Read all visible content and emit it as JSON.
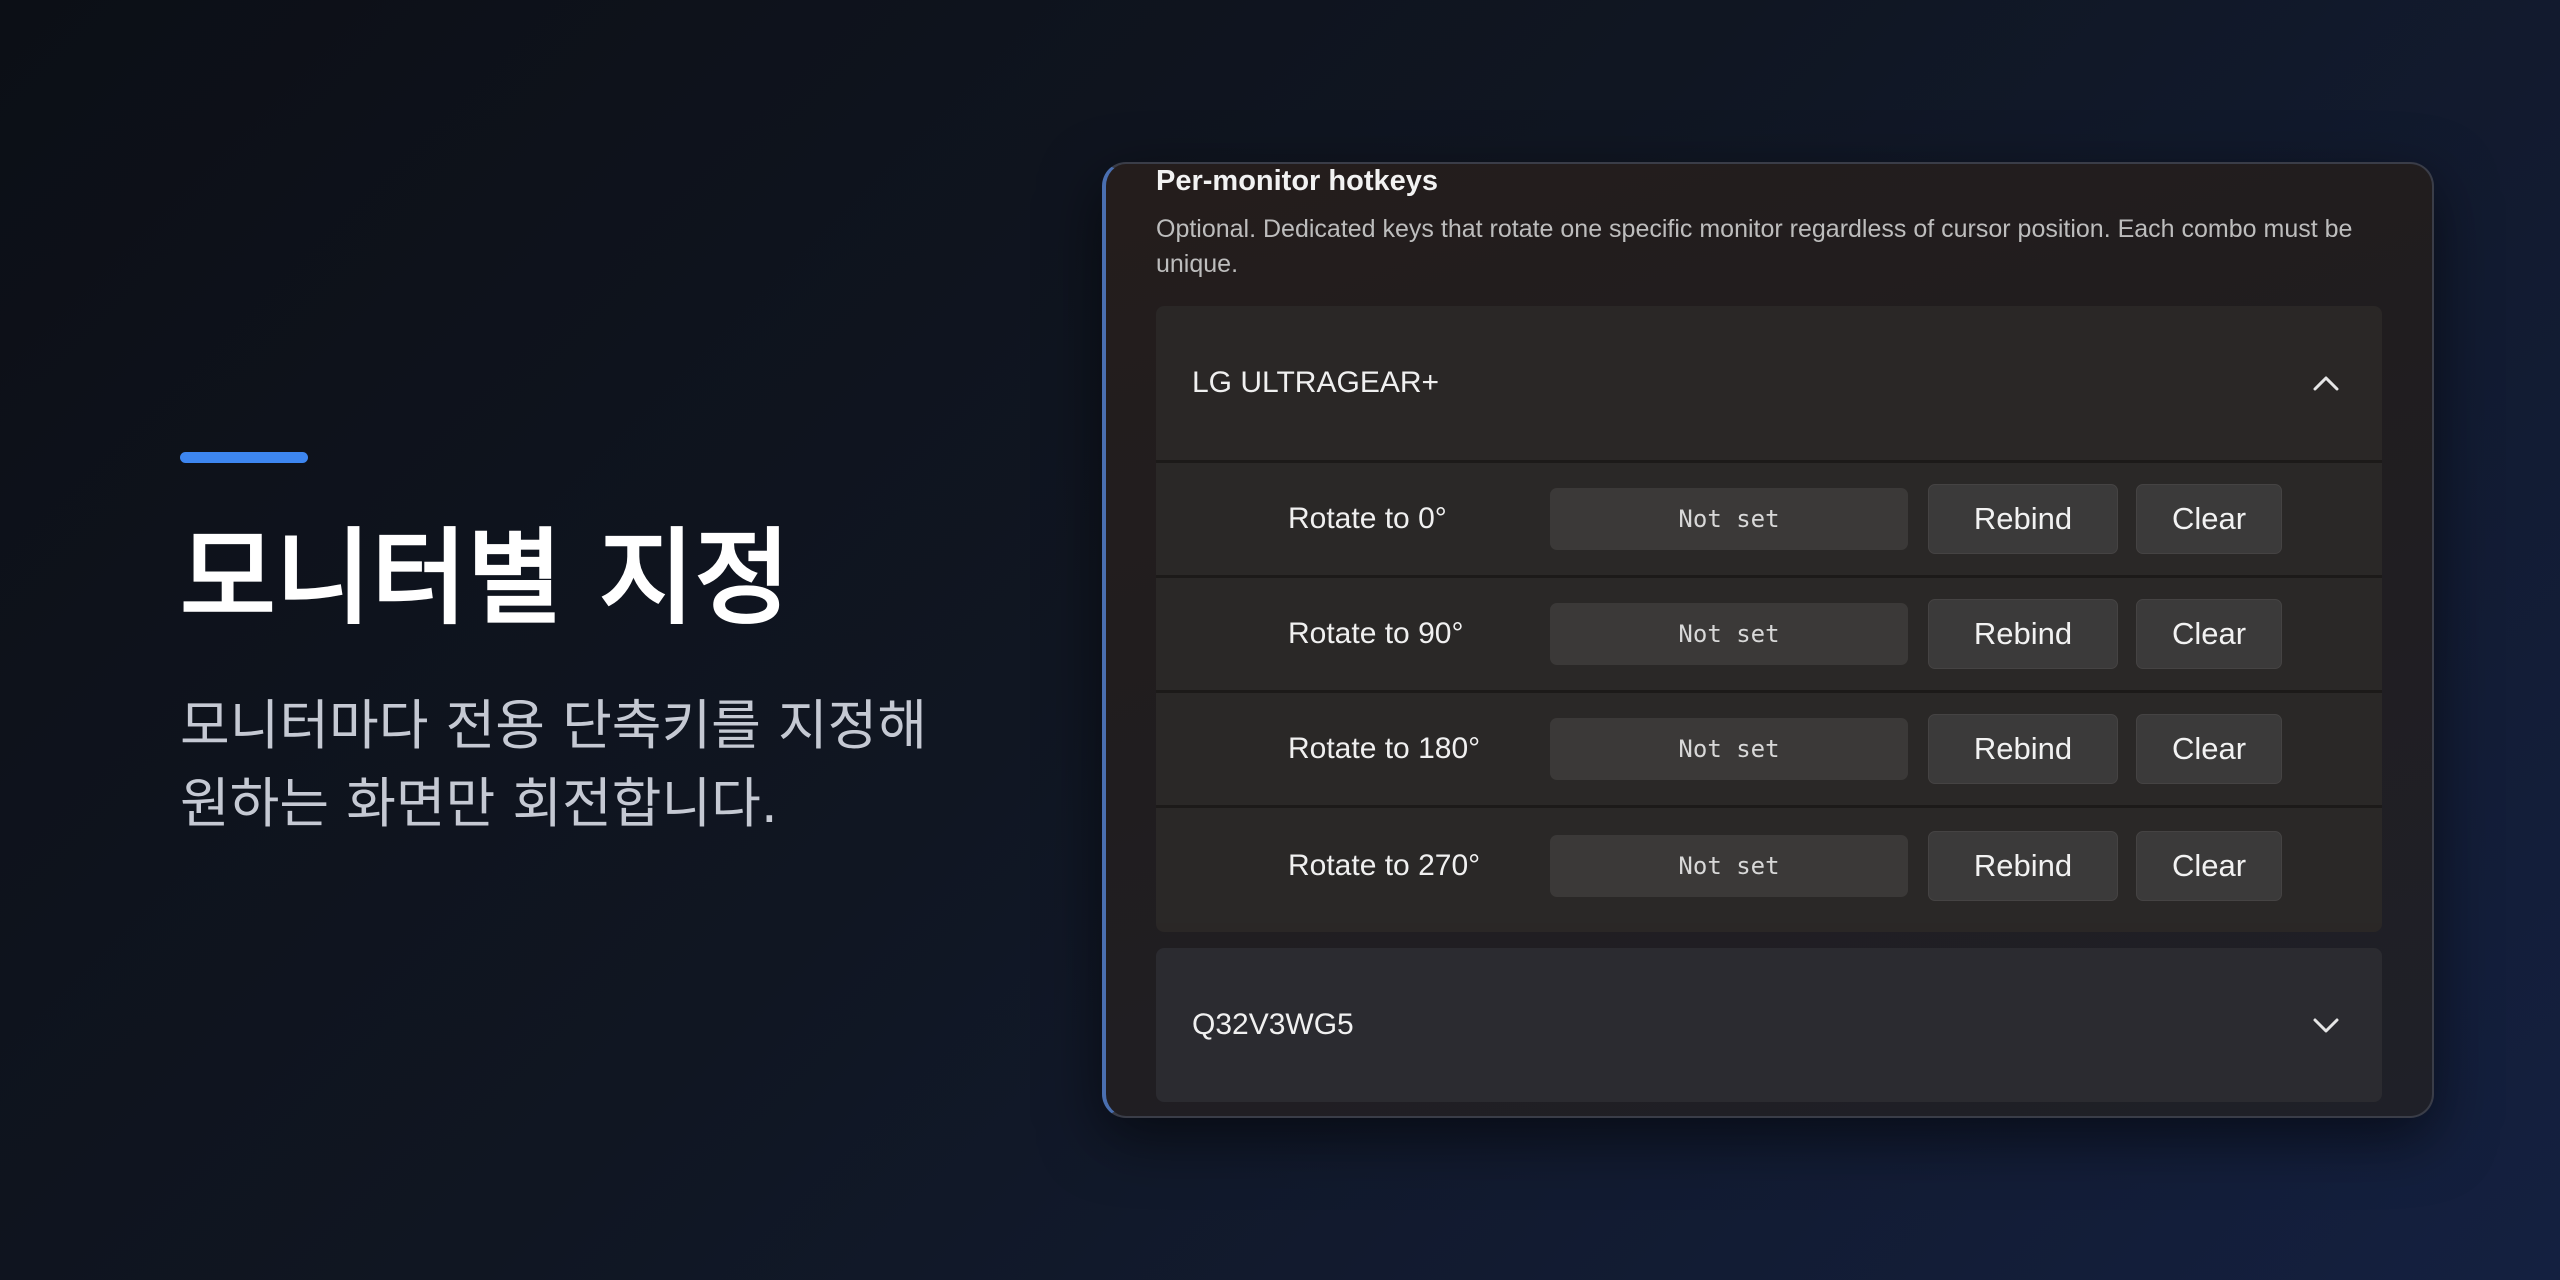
{
  "promo": {
    "title": "모니터별 지정",
    "desc_line1": "모니터마다 전용 단축키를 지정해",
    "desc_line2": "원하는 화면만 회전합니다.",
    "accent_color": "#3d86f0"
  },
  "settings": {
    "section_title": "Per-monitor hotkeys",
    "section_desc": "Optional. Dedicated keys that rotate one specific monitor regardless of cursor position. Each combo must be unique.",
    "monitors": [
      {
        "name": "LG ULTRAGEAR+",
        "expanded": true,
        "chevron_icon": "chevron-up-icon",
        "rows": [
          {
            "label": "Rotate to 0°",
            "value": "Not set",
            "rebind": "Rebind",
            "clear": "Clear"
          },
          {
            "label": "Rotate to 90°",
            "value": "Not set",
            "rebind": "Rebind",
            "clear": "Clear"
          },
          {
            "label": "Rotate to 180°",
            "value": "Not set",
            "rebind": "Rebind",
            "clear": "Clear"
          },
          {
            "label": "Rotate to 270°",
            "value": "Not set",
            "rebind": "Rebind",
            "clear": "Clear"
          }
        ]
      },
      {
        "name": "Q32V3WG5",
        "expanded": false,
        "chevron_icon": "chevron-down-icon"
      }
    ]
  }
}
